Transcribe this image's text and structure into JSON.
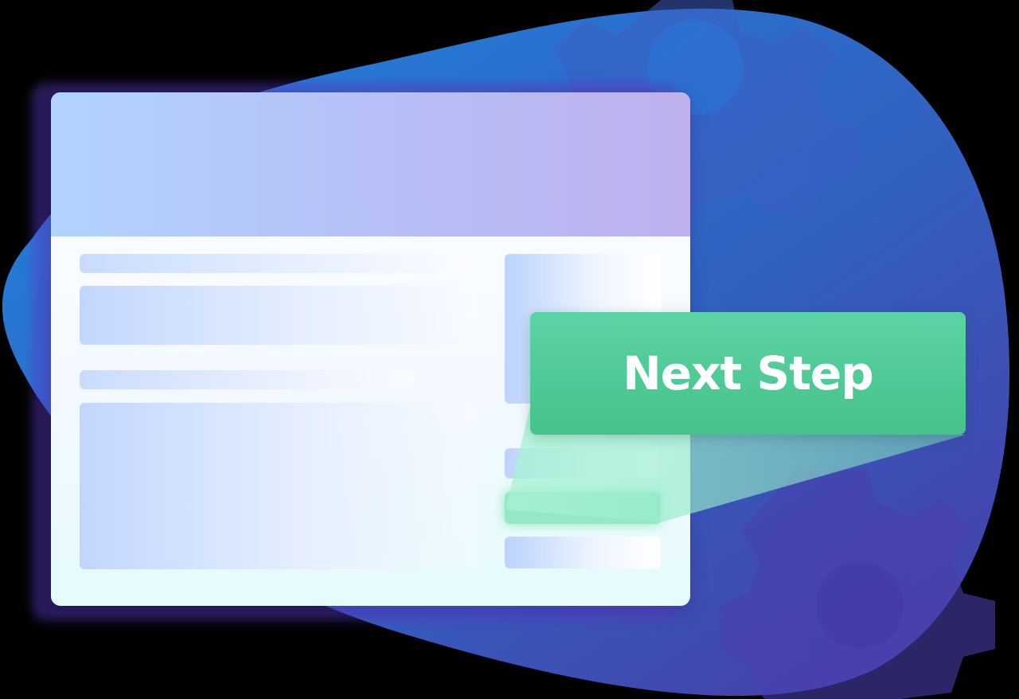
{
  "colors": {
    "blob_start": "#2184df",
    "blob_end": "#4a3aa6",
    "card_header_left": "#b2d3fe",
    "card_header_right": "#beb1ee",
    "accent_green": "#4cc892",
    "highlight_green": "#95e8c3"
  },
  "icons": {
    "background_gear": "gear-icon"
  },
  "cta": {
    "label": "Next Step"
  }
}
